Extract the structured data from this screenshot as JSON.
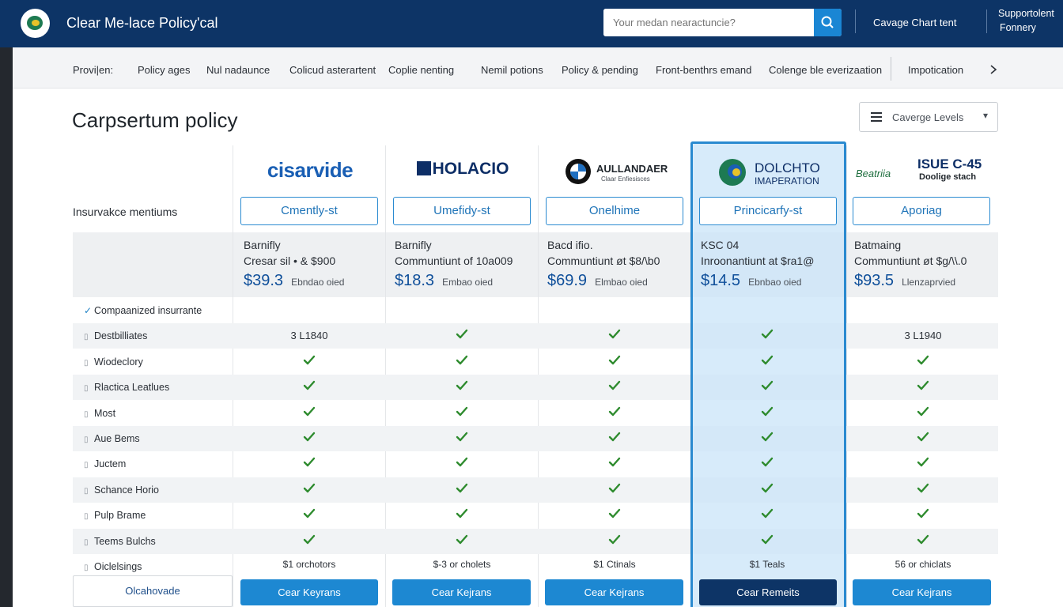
{
  "header": {
    "app_title": "Clear Me-lace Policy'cal",
    "search_placeholder": "Your medan nearactuncie?",
    "coverage_link": "Cavage Chart tent",
    "support_line1": "Supportolent",
    "support_line2": "Fonnery"
  },
  "subnav": {
    "items": [
      "Provi|en:",
      "Policy ages",
      "Nul nadaunce",
      "Colicud asterartent",
      "Coplie nenting",
      "Nemil potions",
      "Policy & pending",
      "Front-benthrs emand",
      "Colenge ble everizaation",
      "Impotication"
    ],
    "next_icon": "chevron-right-icon"
  },
  "page": {
    "title": "Carpsertum policy",
    "coverage_select": "Caverge Levels",
    "insurance_label": "Insurvakce mentiums"
  },
  "providers": [
    {
      "logo_text": "cisarvide",
      "logo_color": "#1a5fb4",
      "plan": "Cmently-st",
      "l1": "Barnifly",
      "l2": "Cresar sil • & $900",
      "price": "$39.3",
      "note": "Ebndao oied",
      "footer": "$1 orchotors",
      "cta": "Cear Keyrans"
    },
    {
      "logo_text": "HOLACIO",
      "logo_color": "#0d2e66",
      "plan": "Umefidy-st",
      "l1": "Barnifly",
      "l2": "Communtiunt of 10a009",
      "price": "$18.3",
      "note": "Embao oied",
      "footer": "$-3 or cholets",
      "cta": "Cear Kejrans"
    },
    {
      "logo_text": "AULLANDAER",
      "logo_sub": "Claar Enfiesisces",
      "logo_color": "#1f252b",
      "plan": "Onelhime",
      "l1": "Bacd ifio.",
      "l2": "Communtiunt øt $8/\\b0",
      "price": "$69.9",
      "note": "Elmbao oied",
      "footer": "$1 Ctinals",
      "cta": "Cear Kejrans"
    },
    {
      "logo_text": "DOLCHTO",
      "logo_sub": "IMAPERATION",
      "logo_color": "#0d2e66",
      "plan": "Princicarfy-st",
      "l1": "KSC 04",
      "l2": "Inroonantiunt at $ra1@",
      "price": "$14.5",
      "note": "Ebnbao oied",
      "footer": "$1 Teals",
      "cta": "Cear Remeits"
    },
    {
      "logo_text": "ISUE C-45",
      "logo_sub": "Doolige stach",
      "logo_left": "Beatriia",
      "logo_color": "#0d2e66",
      "plan": "Aporiag",
      "l1": "Batmaing",
      "l2": "Communtiunt øt $g/\\\\.0",
      "price": "$93.5",
      "note": "Llenzaprvied",
      "footer": "56 or chiclats",
      "cta": "Cear Kejrans"
    }
  ],
  "features": [
    {
      "label": "Compaanized insurrante",
      "bullet": "check",
      "values": [
        "",
        "",
        "",
        "",
        ""
      ]
    },
    {
      "label": "Destbilliates",
      "bullet": "box",
      "values": [
        "3 L1840",
        "check",
        "check",
        "check",
        "3 L1940"
      ]
    },
    {
      "label": "Wiodeclory",
      "bullet": "box",
      "values": [
        "check",
        "check",
        "check",
        "check",
        "check"
      ]
    },
    {
      "label": "Rlactica Leatlues",
      "bullet": "box",
      "values": [
        "check",
        "check",
        "check",
        "check",
        "check"
      ]
    },
    {
      "label": "Most",
      "bullet": "box",
      "values": [
        "check",
        "check",
        "check",
        "check",
        "check"
      ]
    },
    {
      "label": "Aue Bems",
      "bullet": "box",
      "values": [
        "check",
        "check",
        "check",
        "check",
        "check"
      ]
    },
    {
      "label": "Juctem",
      "bullet": "box",
      "values": [
        "check",
        "check",
        "check",
        "check",
        "check"
      ]
    },
    {
      "label": "Schance Horio",
      "bullet": "box",
      "values": [
        "check",
        "check",
        "check",
        "check",
        "check"
      ]
    },
    {
      "label": "Pulp Brame",
      "bullet": "box",
      "values": [
        "check",
        "check",
        "check",
        "check",
        "check"
      ]
    },
    {
      "label": "Teems Bulchs",
      "bullet": "box",
      "values": [
        "check",
        "check",
        "check",
        "check",
        "check"
      ]
    },
    {
      "label": "Oiclelsings",
      "bullet": "box",
      "values": [
        "footer",
        "footer",
        "footer",
        "footer",
        "footer"
      ]
    }
  ],
  "footer": {
    "label": "Olcahovade"
  },
  "colors": {
    "brand": "#0d3466",
    "accent": "#1d88d2",
    "check": "#2e8b2e",
    "highlight_border": "#2a8ad0"
  }
}
